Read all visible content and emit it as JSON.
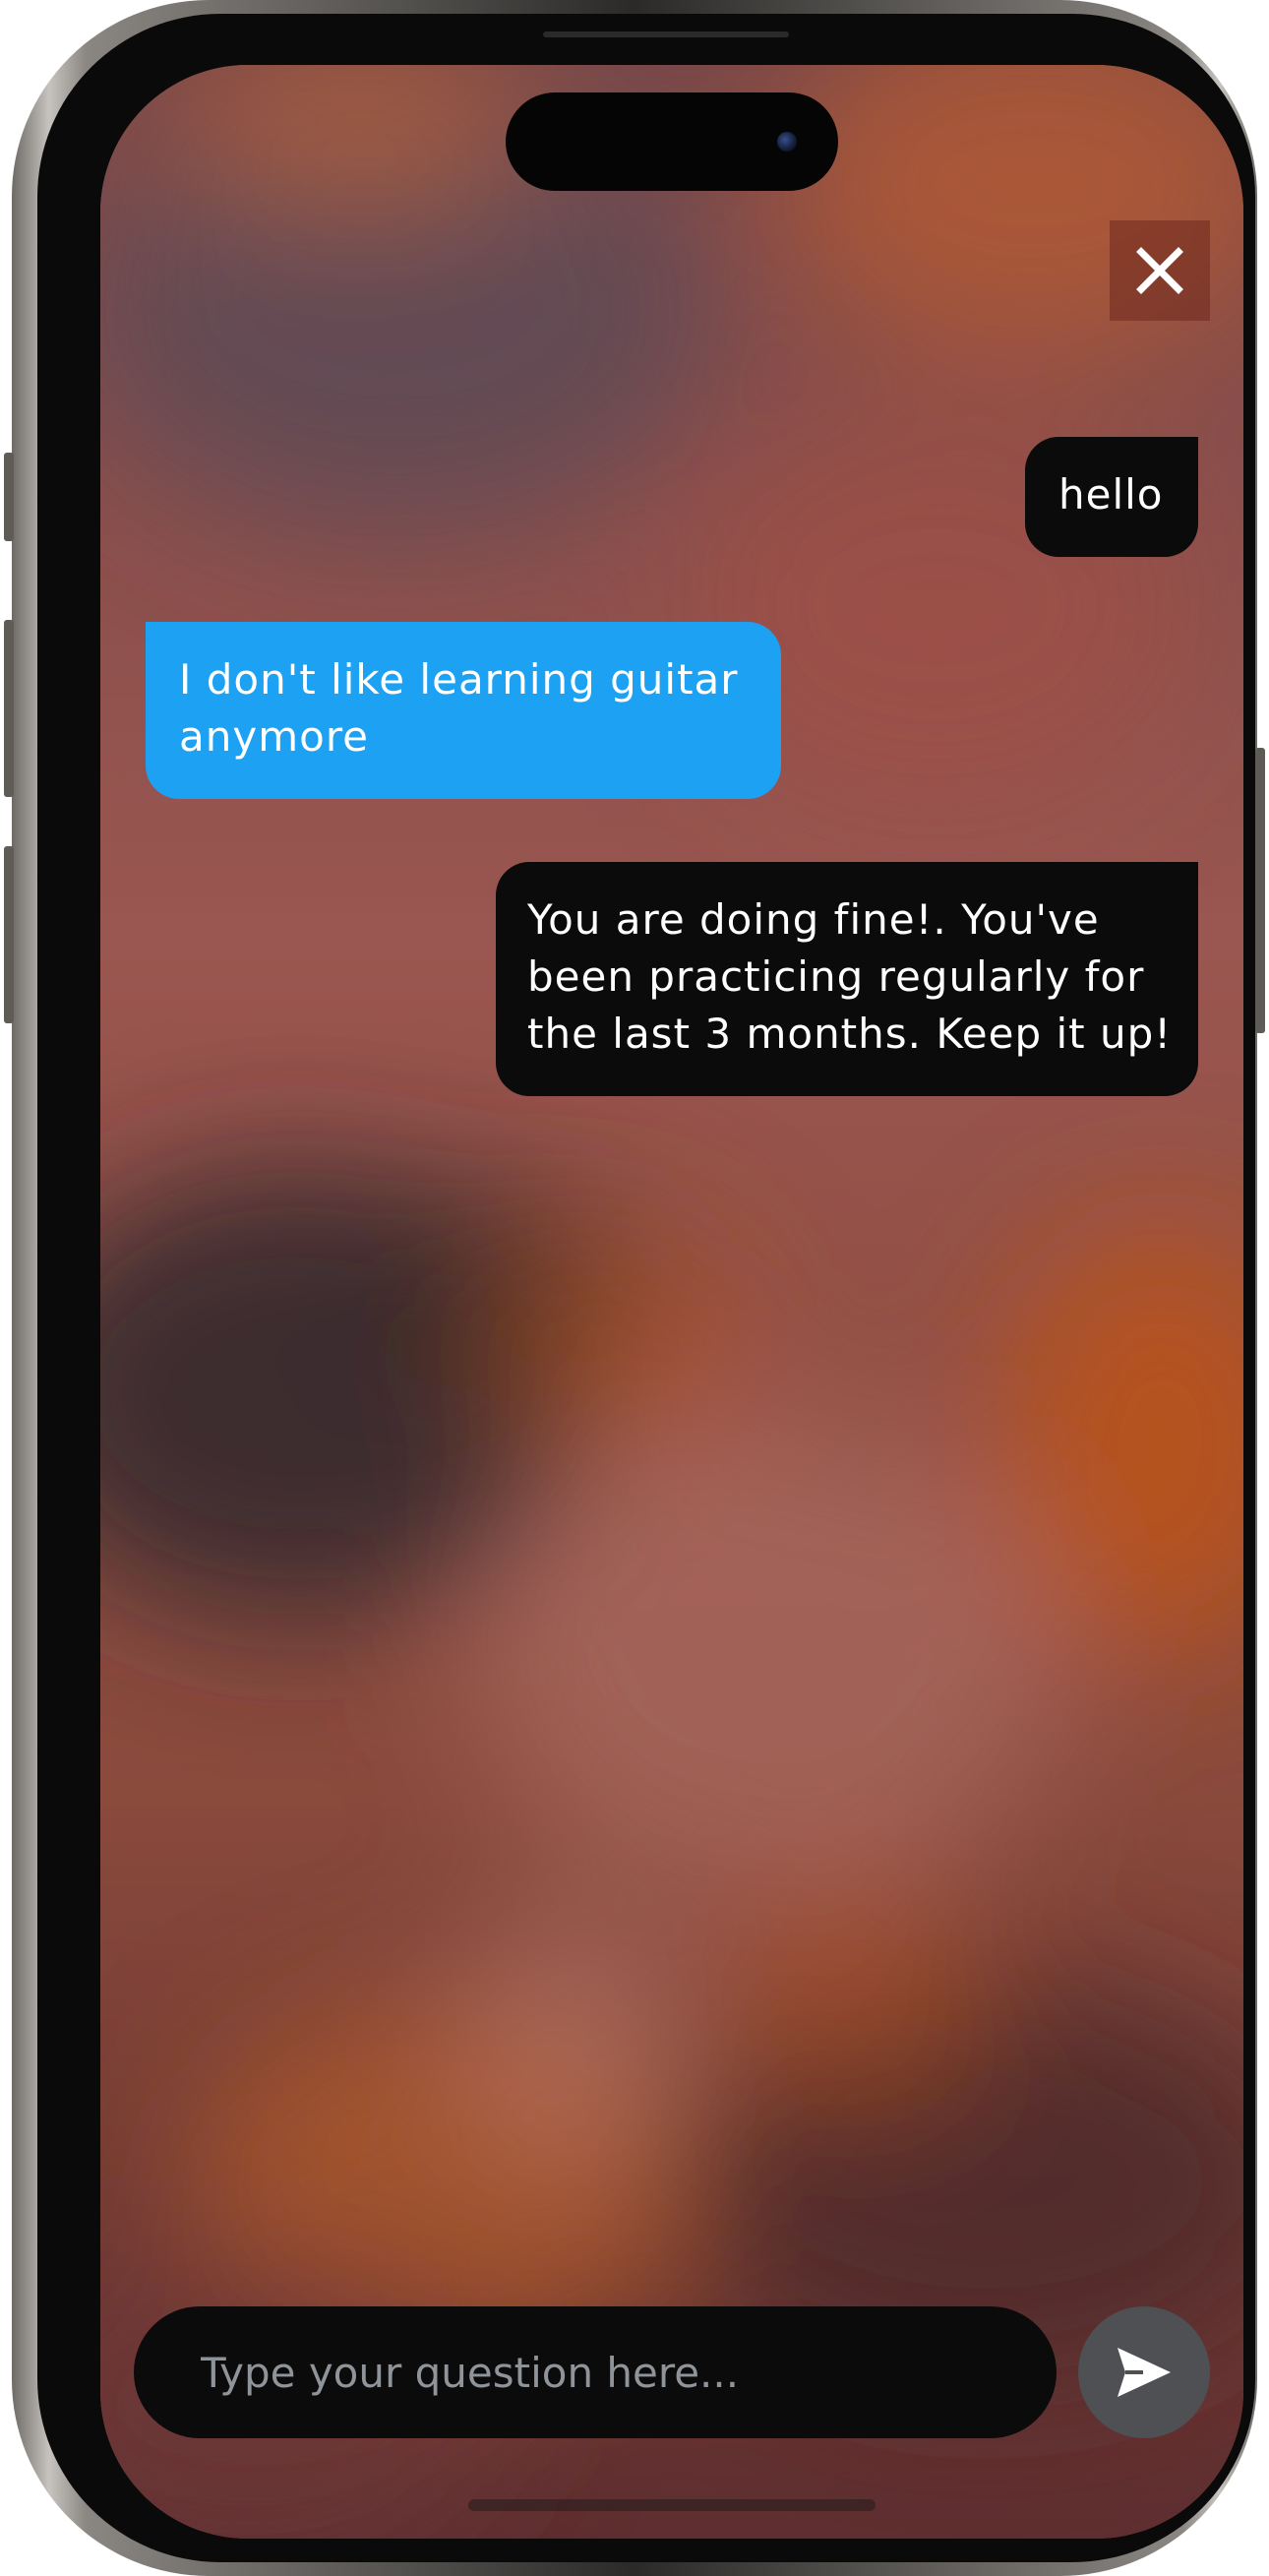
{
  "chat": {
    "messages": [
      {
        "role": "user",
        "text": "hello"
      },
      {
        "role": "assistant",
        "text": "I don't like learning guitar anymore"
      },
      {
        "role": "user",
        "text": "You are doing fine!. You've been practicing regularly for the last 3 months. Keep it up!"
      }
    ]
  },
  "composer": {
    "placeholder": "Type your question here...",
    "value": ""
  },
  "icons": {
    "close": "close-icon",
    "send": "send-icon"
  },
  "colors": {
    "assistant_bubble": "#1da1f2",
    "user_bubble": "#0b0b0b",
    "send_button": "#4f5053",
    "input_bar": "#0b0b0b"
  }
}
